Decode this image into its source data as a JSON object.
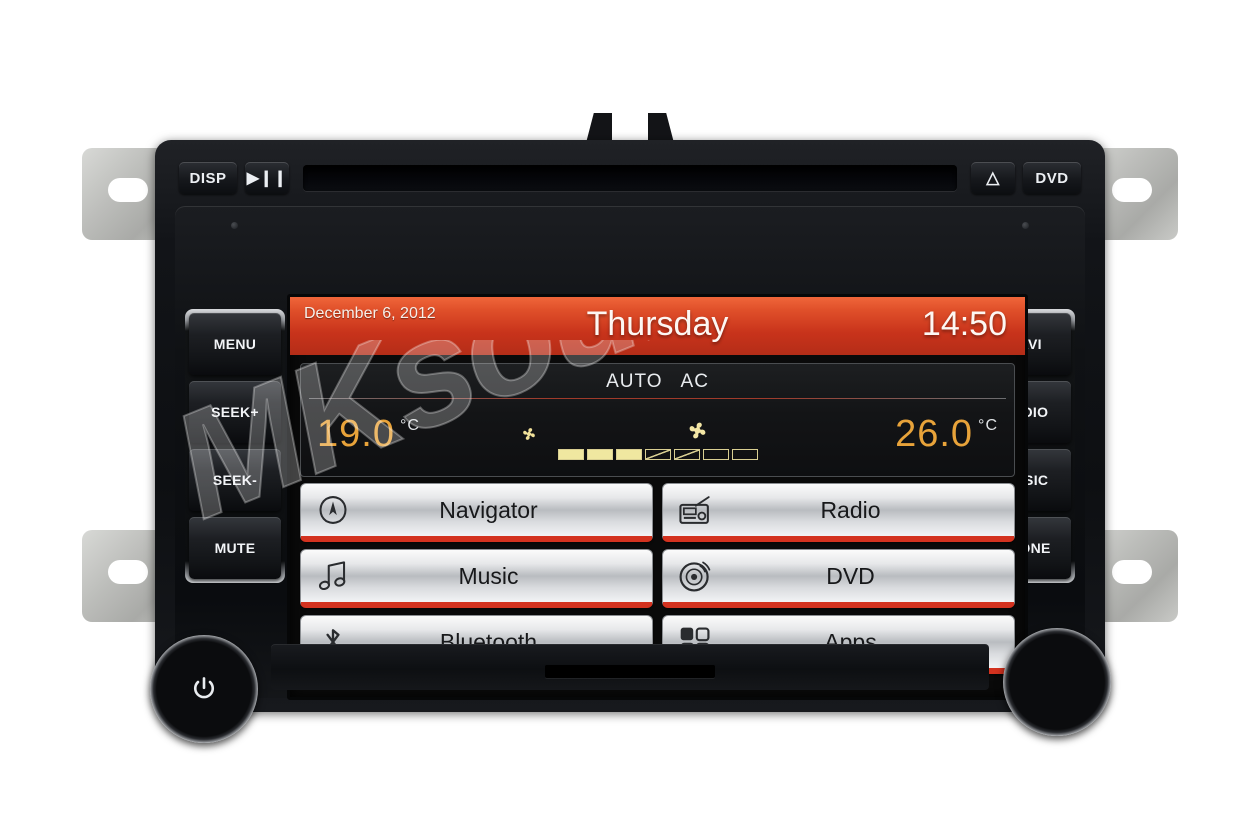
{
  "device": {
    "name": "car-head-unit",
    "top_bar": {
      "disp_label": "DISP",
      "play_label": "▶❙❙",
      "eject_label": "△",
      "dvd_label": "DVD",
      "cd_slot_name": "cd-slot"
    },
    "left_buttons": [
      {
        "label": "MENU"
      },
      {
        "label": "SEEK+"
      },
      {
        "label": "SEEK-"
      },
      {
        "label": "MUTE"
      }
    ],
    "right_buttons": [
      {
        "label": "NAVI"
      },
      {
        "label": "RADIO"
      },
      {
        "label": "MUSIC"
      },
      {
        "label": "PHONE"
      }
    ],
    "knobs": {
      "left": {
        "icon": "power-icon",
        "symbol": "⏻"
      },
      "right": {
        "icon": "rotary-knob",
        "symbol": ""
      }
    }
  },
  "screen": {
    "header": {
      "date": "December 6, 2012",
      "day": "Thursday",
      "time": "14:50"
    },
    "climate": {
      "modes": [
        "AUTO",
        "AC"
      ],
      "left_temp": "19.0",
      "left_unit": "°C",
      "right_temp": "26.0",
      "right_unit": "°C",
      "fan_bars_total": 7,
      "fan_bars_filled": 3,
      "fan_icon_small": "fan-icon-small",
      "fan_icon_large": "fan-icon-large"
    },
    "menu": [
      {
        "label": "Navigator",
        "icon": "compass-icon"
      },
      {
        "label": "Radio",
        "icon": "radio-icon"
      },
      {
        "label": "Music",
        "icon": "music-note-icon"
      },
      {
        "label": "DVD",
        "icon": "disc-icon"
      },
      {
        "label": "Bluetooth",
        "icon": "bluetooth-icon"
      },
      {
        "label": "Apps",
        "icon": "grid-apps-icon"
      }
    ]
  },
  "watermark": {
    "text": "MKsound"
  },
  "colors": {
    "header_accent": "#d3321f",
    "temp_amber": "#e8a33a",
    "fan_bar": "#f0e7a0",
    "button_face": "#e7e8ea"
  }
}
